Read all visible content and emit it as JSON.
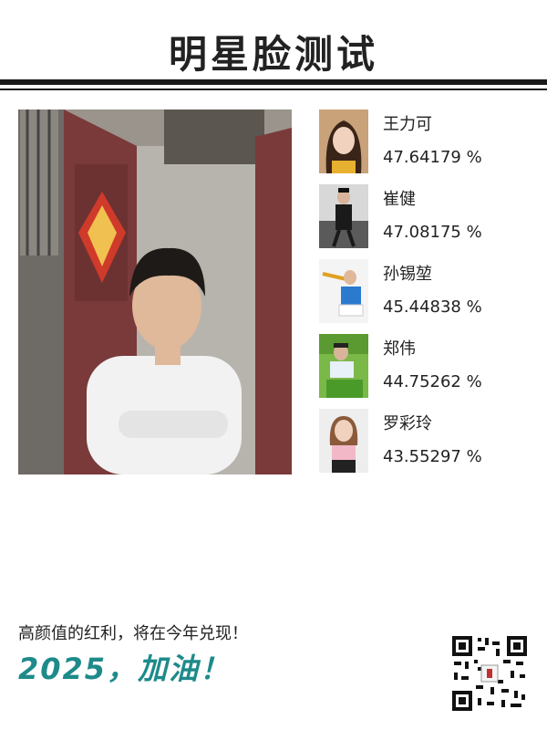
{
  "header": {
    "title": "明星脸测试"
  },
  "matches": [
    {
      "name": "王力可",
      "score": "47.64179 %"
    },
    {
      "name": "崔健",
      "score": "47.08175 %"
    },
    {
      "name": "孙锡堃",
      "score": "45.44838 %"
    },
    {
      "name": "郑伟",
      "score": "44.75262 %"
    },
    {
      "name": "罗彩玲",
      "score": "43.55297 %"
    }
  ],
  "footer": {
    "slogan": "高颜值的红利，将在今年兑现！",
    "year_text": "2025，加油！"
  },
  "colors": {
    "accent": "#1e8a8a",
    "rule": "#1a1a1a",
    "door_red": "#7a3a3a"
  }
}
